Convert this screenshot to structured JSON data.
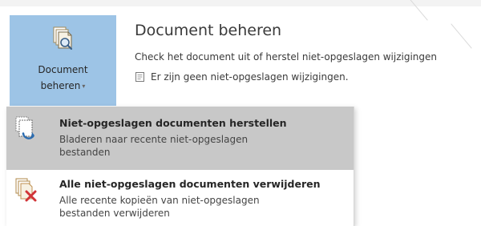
{
  "manage_button": {
    "label_line1": "Document",
    "label_line2": "beheren",
    "caret": "▾",
    "icon": "manage-document-icon"
  },
  "info": {
    "title": "Document beheren",
    "description": "Check het document uit of herstel niet-opgeslagen wijzigingen",
    "status": "Er zijn geen niet-opgeslagen wijzigingen.",
    "status_icon": "document-icon"
  },
  "menu": {
    "items": [
      {
        "title": "Niet-opgeslagen documenten herstellen",
        "desc_line1": "Bladeren naar recente niet-opgeslagen",
        "desc_line2": "bestanden",
        "icon": "recover-document-icon",
        "selected": true
      },
      {
        "title": "Alle niet-opgeslagen documenten verwijderen",
        "desc_line1": "Alle recente kopieën van niet-opgeslagen",
        "desc_line2": "bestanden verwijderen",
        "icon": "delete-documents-icon",
        "selected": false
      }
    ]
  },
  "colors": {
    "button_bg": "#9dc4e6",
    "selected_bg": "#c8c8c8",
    "accent_blue": "#2b6cb0",
    "delete_red": "#d13438"
  }
}
